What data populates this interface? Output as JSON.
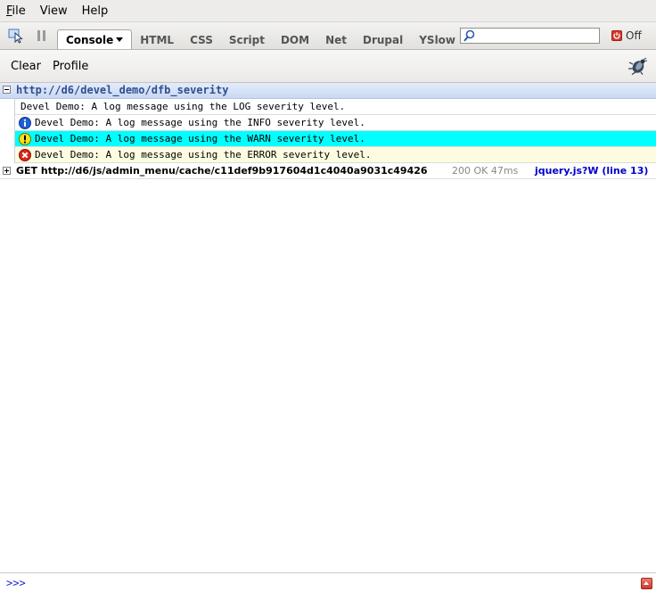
{
  "menubar": {
    "items": [
      {
        "label": "File",
        "mnemonic": "F",
        "rest": "ile"
      },
      {
        "label": "View"
      },
      {
        "label": "Help"
      }
    ]
  },
  "toolbar": {
    "tabs": [
      {
        "label": "Console",
        "active": true
      },
      {
        "label": "HTML"
      },
      {
        "label": "CSS"
      },
      {
        "label": "Script"
      },
      {
        "label": "DOM"
      },
      {
        "label": "Net"
      },
      {
        "label": "Drupal"
      },
      {
        "label": "YSlow"
      }
    ],
    "search": {
      "value": "",
      "placeholder": ""
    },
    "off_label": "Off"
  },
  "console_toolbar": {
    "clear_label": "Clear",
    "profile_label": "Profile"
  },
  "log": {
    "group": {
      "title": "http://d6/devel_demo/dfb_severity",
      "expanded": true,
      "messages": [
        {
          "severity": "log",
          "text": "Devel Demo: A log message using the LOG severity level."
        },
        {
          "severity": "info",
          "text": "Devel Demo: A log message using the INFO severity level."
        },
        {
          "severity": "warn",
          "text": "Devel Demo: A log message using the WARN severity level."
        },
        {
          "severity": "error",
          "text": "Devel Demo: A log message using the ERROR severity level."
        }
      ]
    },
    "request": {
      "text": "GET http://d6/js/admin_menu/cache/c11def9b917604d1c4040a9031c49426",
      "status": "200 OK 47ms",
      "source": "jquery.js?W (line 13)"
    }
  },
  "command_line": {
    "prompt": ">>>",
    "value": ""
  },
  "colors": {
    "warn_row": "#00ffff",
    "error_row": "#fdfce0",
    "link": "#0000cc",
    "group_title": "#2f4f8f"
  }
}
